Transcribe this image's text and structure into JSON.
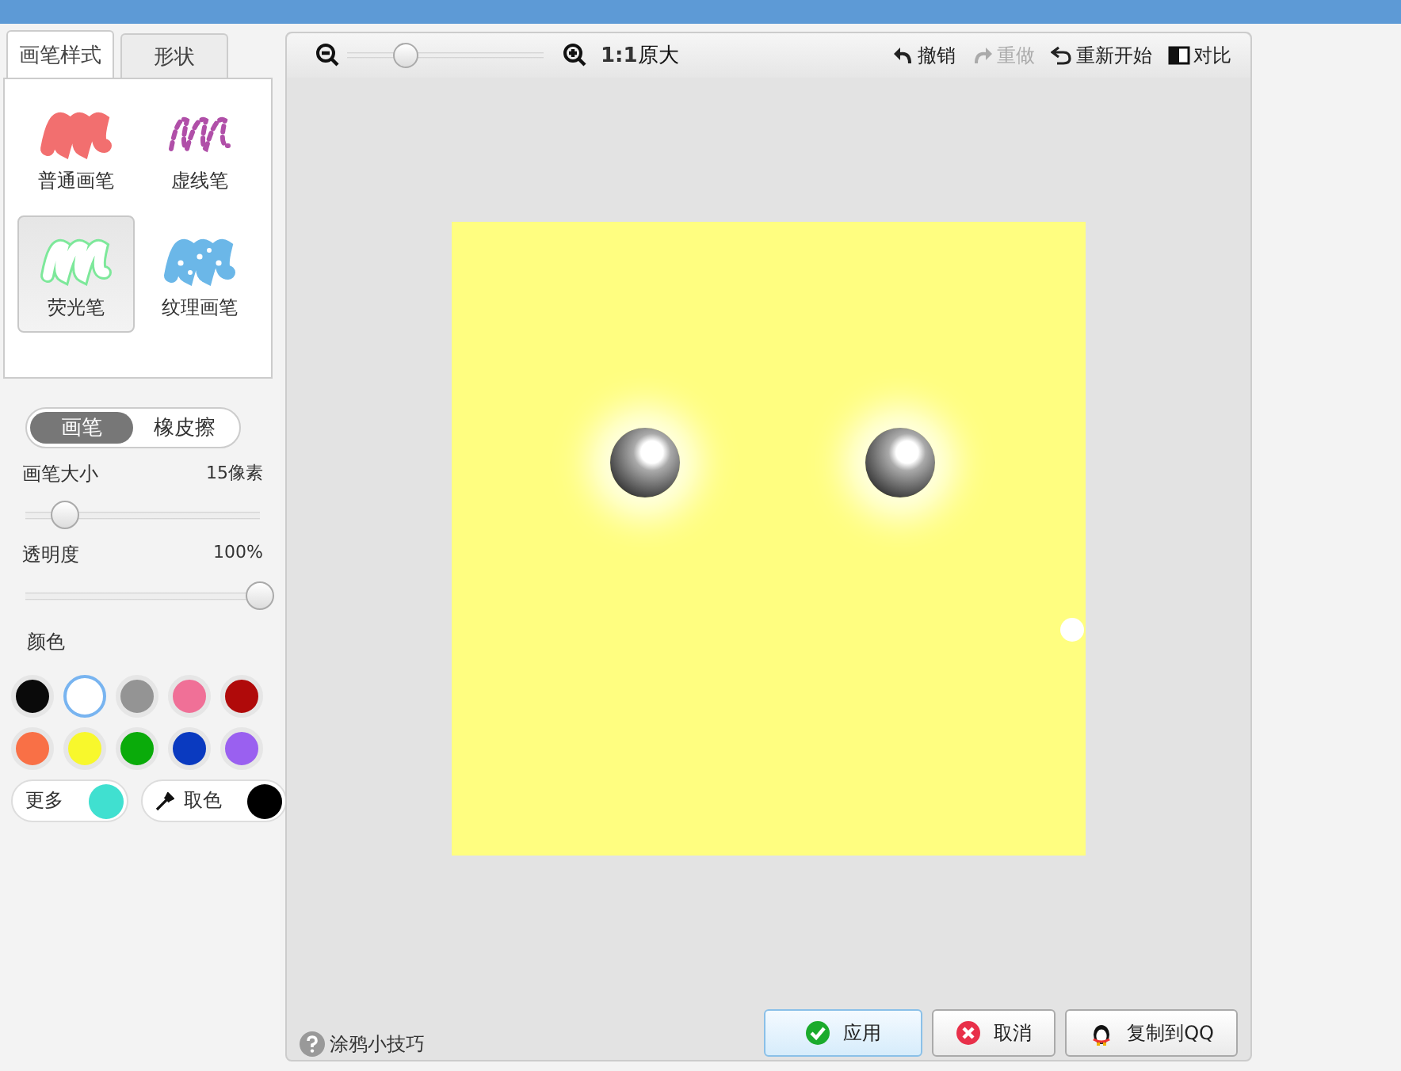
{
  "tabs": [
    {
      "label": "画笔样式",
      "selected": true
    },
    {
      "label": "形状",
      "selected": false
    }
  ],
  "brush_styles": [
    {
      "label": "普通画笔",
      "kind": "solid",
      "color": "#f26f6f",
      "selected": false
    },
    {
      "label": "虚线笔",
      "kind": "dashed",
      "color": "#b04fa8",
      "selected": false
    },
    {
      "label": "荧光笔",
      "kind": "glow",
      "color": "#7de89a",
      "selected": true
    },
    {
      "label": "纹理画笔",
      "kind": "dotted",
      "color": "#6bb7e8",
      "selected": false
    }
  ],
  "tool_toggle": [
    {
      "label": "画笔",
      "selected": true
    },
    {
      "label": "橡皮擦",
      "selected": false
    }
  ],
  "sliders": [
    {
      "label": "画笔大小",
      "reading": "15像素",
      "level": 0.17
    },
    {
      "label": "透明度",
      "reading": "100%",
      "level": 1
    }
  ],
  "colors_label": "颜色",
  "colors": [
    {
      "color": "#0a0a0a",
      "selected": false
    },
    {
      "color": "#ffffff",
      "selected": true
    },
    {
      "color": "#949494",
      "selected": false
    },
    {
      "color": "#f07097",
      "selected": false
    },
    {
      "color": "#b00a0a",
      "selected": false
    },
    {
      "color": "#f97046",
      "selected": false
    },
    {
      "color": "#f8f82c",
      "selected": false
    },
    {
      "color": "#0aab0a",
      "selected": false
    },
    {
      "color": "#0a3ac0",
      "selected": false
    },
    {
      "color": "#9a60f0",
      "selected": false
    }
  ],
  "more_colors": {
    "label": "更多",
    "color": "#40e0d0"
  },
  "pick_color": {
    "label": "取色",
    "color": "#000000"
  },
  "zoom": {
    "level": 0.3,
    "ratio": "1:1",
    "ratio_label": "原大"
  },
  "toolbar": [
    {
      "label": "撤销",
      "kind": "undo",
      "disabled": false
    },
    {
      "label": "重做",
      "kind": "redo",
      "disabled": true
    },
    {
      "label": "重新开始",
      "kind": "restart",
      "disabled": false
    },
    {
      "label": "对比",
      "kind": "compare",
      "disabled": false
    }
  ],
  "tip": "涂鸦小技巧",
  "buttons": [
    {
      "label": "应用",
      "kind": "apply"
    },
    {
      "label": "取消",
      "kind": "cancel"
    },
    {
      "label": "复制到QQ",
      "kind": "qq"
    }
  ]
}
